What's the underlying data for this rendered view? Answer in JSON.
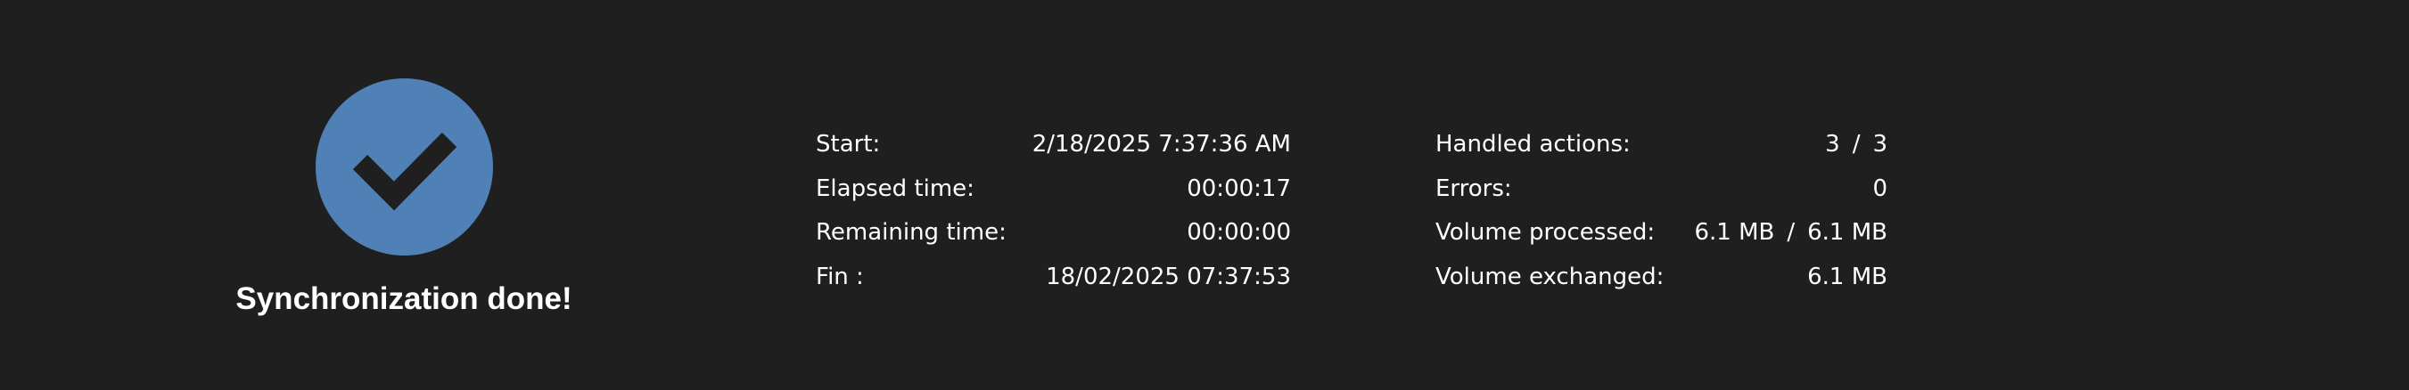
{
  "status": {
    "title": "Synchronization done!",
    "icon": "checkmark-icon",
    "accent_color": "#4f81b6",
    "icon_color": "#1f1f1f"
  },
  "timing": [
    {
      "label": "Start:",
      "value": "2/18/2025 7:37:36 AM"
    },
    {
      "label": "Elapsed time:",
      "value": "00:00:17"
    },
    {
      "label": "Remaining time:",
      "value": "00:00:00"
    },
    {
      "label": "Fin :",
      "value": "18/02/2025 07:37:53"
    }
  ],
  "progress": {
    "handled_actions": {
      "label": "Handled actions:",
      "done": "3",
      "separator": "/",
      "total": "3"
    },
    "errors": {
      "label": "Errors:",
      "value": "0"
    },
    "volume_processed": {
      "label": "Volume processed:",
      "done": "6.1 MB",
      "separator": "/",
      "total": "6.1 MB"
    },
    "volume_exchanged": {
      "label": "Volume exchanged:",
      "value": "6.1 MB"
    }
  }
}
